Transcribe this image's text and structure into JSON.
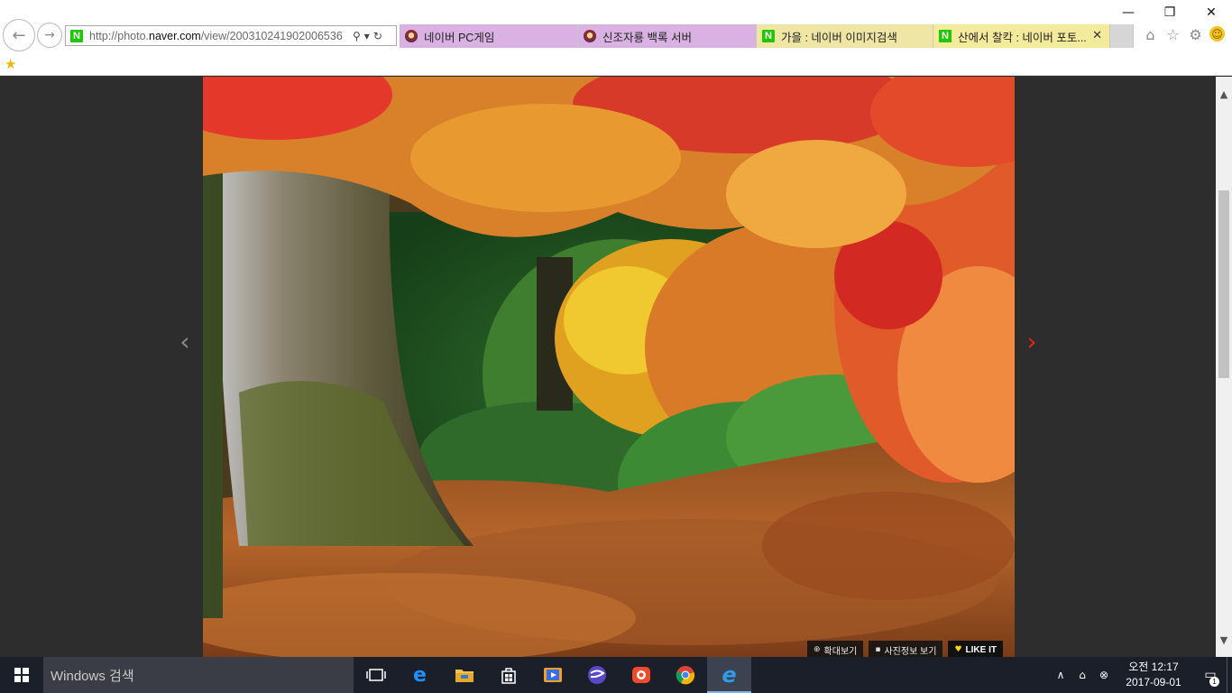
{
  "browser": {
    "url_prefix": "http://photo.",
    "url_host": "naver.com",
    "url_rest": "/view/200310241902006536",
    "tabs": [
      {
        "title": "네이버 PC게임",
        "bg": "#d9b2e3",
        "icon": "game-favicon",
        "width": 198
      },
      {
        "title": "신조자룡 백록 서버",
        "bg": "#d9b2e3",
        "icon": "game-favicon",
        "width": 198
      },
      {
        "title": "가을 : 네이버 이미지검색",
        "bg": "#efe6a6",
        "icon": "naver-favicon",
        "width": 196
      },
      {
        "title": "산에서 찰칵 : 네이버 포토...",
        "bg": "#f4ea9c",
        "icon": "naver-favicon",
        "width": 196
      }
    ],
    "naver_letter": "N",
    "close_glyph": "✕",
    "window_controls": {
      "minimize": "—",
      "restore": "❐",
      "close": "✕"
    }
  },
  "photo_view": {
    "buttons": {
      "zoom": "확대보기",
      "info": "사진정보 보기",
      "like": "LIKE IT"
    }
  },
  "taskbar": {
    "search_placeholder": "Windows 검색",
    "apps": [
      "task-view",
      "edge",
      "file-explorer",
      "store",
      "media-player",
      "app-blue-sphere",
      "app-red-camera",
      "chrome",
      "internet-explorer"
    ],
    "clock_period_time": "오전 12:17",
    "clock_date": "2017-09-01",
    "notification_count": "1"
  },
  "colors": {
    "accent_red": "#e2231a",
    "naver_green": "#1ec800",
    "taskbar_bg": "#1b1f2a"
  }
}
